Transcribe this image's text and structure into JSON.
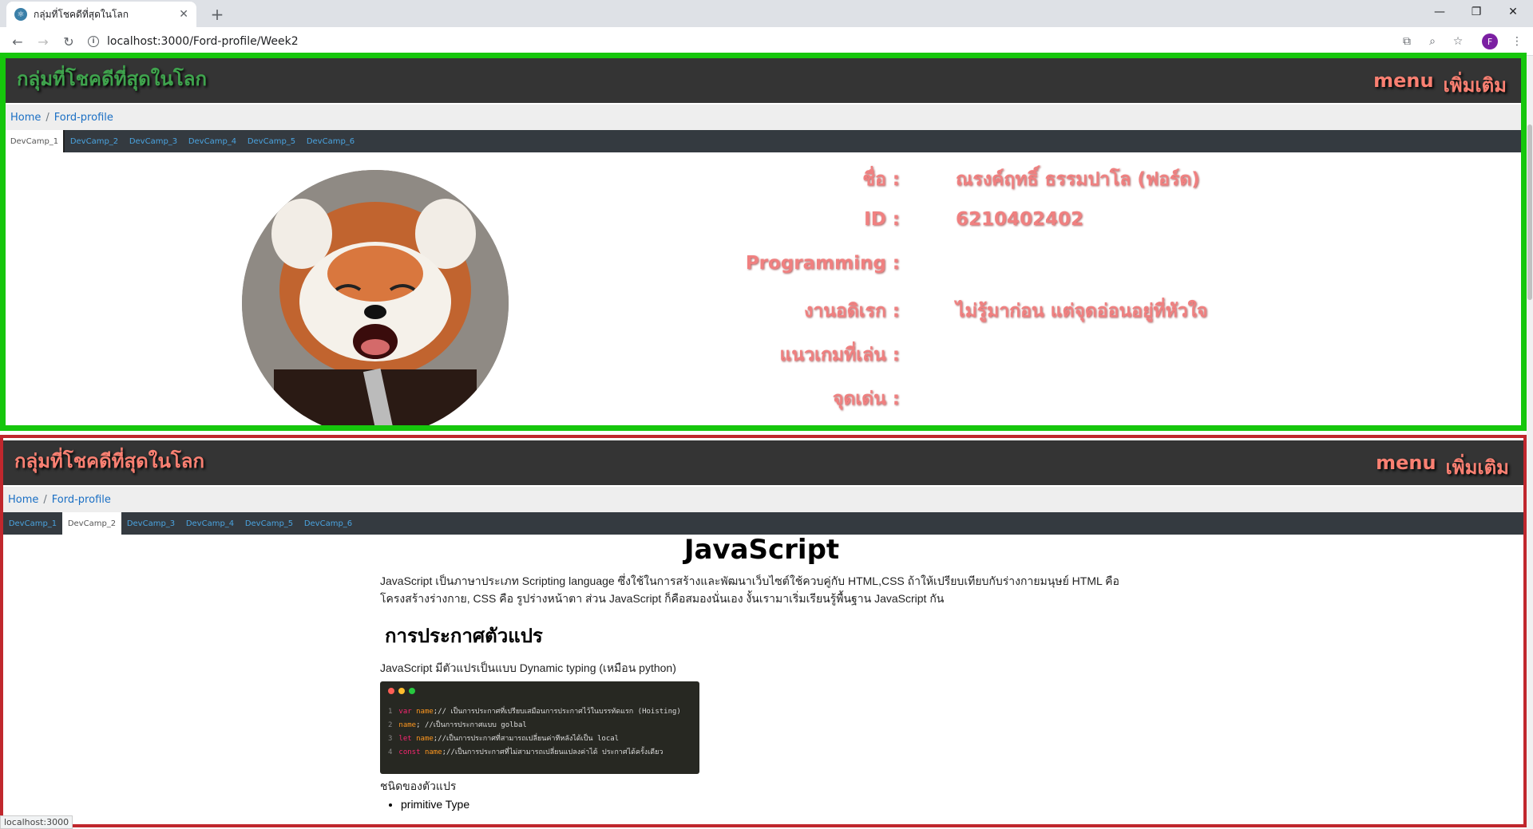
{
  "browser": {
    "tab_title": "กลุ่มที่โชคดีที่สุดในโลก",
    "url": "localhost:3000/Ford-profile/Week2",
    "profile_initial": "F",
    "status_text": "localhost:3000"
  },
  "header": {
    "site_title": "กลุ่มที่โชคดีที่สุดในโลก",
    "menu_label": "menu",
    "more_label": "เพิ่มเติม"
  },
  "breadcrumb": {
    "home": "Home",
    "current": "Ford-profile"
  },
  "camp_tabs": [
    "DevCamp_1",
    "DevCamp_2",
    "DevCamp_3",
    "DevCamp_4",
    "DevCamp_5",
    "DevCamp_6"
  ],
  "profile": {
    "rows": [
      {
        "label": "ชื่อ :",
        "value": "ณรงค์ฤทธิ์ ธรรมปาโล (ฟอร์ด)"
      },
      {
        "label": "ID :",
        "value": "6210402402"
      },
      {
        "label": "Programming :",
        "value": ""
      },
      {
        "label": "งานอดิเรก :",
        "value": "ไม่รู้มาก่อน แต่จุดอ่อนอยู่ที่หัวใจ"
      },
      {
        "label": "แนวเกมที่เล่น :",
        "value": ""
      },
      {
        "label": "จุดเด่น :",
        "value": ""
      }
    ]
  },
  "article": {
    "title": "JavaScript",
    "intro": "JavaScript เป็นภาษาประเภท Scripting language ซึ่งใช้ในการสร้างและพัฒนาเว็บไซต์ใช้ควบคู่กับ HTML,CSS ถ้าให้เปรียบเทียบกับร่างกายมนุษย์ HTML คือ โครงสร้างร่างกาย, CSS คือ รูปร่างหน้าตา ส่วน JavaScript ก็คือสมองนั่นเอง งั้นเรามาเริ่มเรียนรู้พื้นฐาน JavaScript กัน",
    "section_title": "การประกาศตัวแปร",
    "section_intro": "JavaScript มีตัวแปรเป็นแบบ Dynamic typing (เหมือน python)",
    "code_lines": [
      {
        "n": "1",
        "kw": "var",
        "name": "name",
        "rest": ";// เป็นการประกาศที่เปรียบเสมือนการประกาศไว้ในบรรทัดแรก (Hoisting)"
      },
      {
        "n": "2",
        "kw": "",
        "name": "name",
        "rest": "; //เป็นการประกาศแบบ golbal"
      },
      {
        "n": "3",
        "kw": "let",
        "name": "name",
        "rest": ";//เป็นการประกาศที่สามารถเปลี่ยนค่าทีหลังได้เป็น local"
      },
      {
        "n": "4",
        "kw": "const",
        "name": "name",
        "rest": ";//เป็นการประกาศที่ไม่สามารถเปลี่ยนแปลงค่าได้ ประกาศได้ครั้งเดียว"
      }
    ],
    "types_heading": "ชนิดของตัวแปร",
    "types": [
      "primitive Type"
    ]
  },
  "colors": {
    "green_border": "#16c60c",
    "red_border": "#c0272d",
    "accent": "#fa8072"
  }
}
